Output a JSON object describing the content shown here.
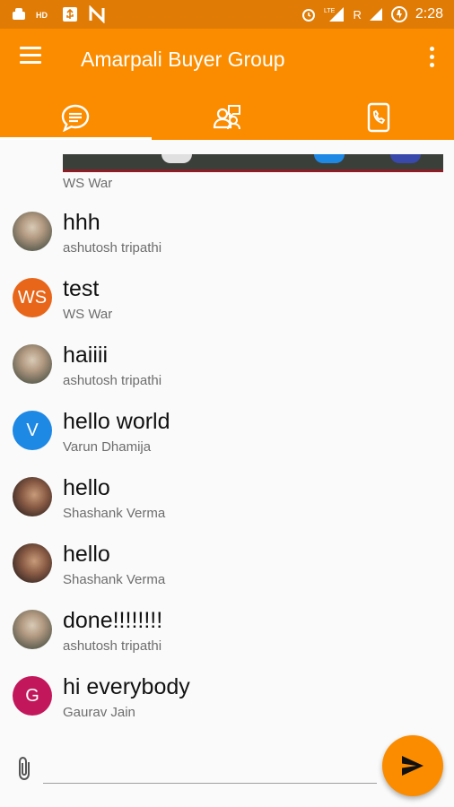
{
  "status_bar": {
    "time": "2:28",
    "network_label": "R"
  },
  "app": {
    "title": "Amarpali Buyer Group"
  },
  "tabs": [
    {
      "icon": "chat-bubble-icon",
      "active": true
    },
    {
      "icon": "group-icon",
      "active": false
    },
    {
      "icon": "contact-phone-icon",
      "active": false
    }
  ],
  "previous_message": {
    "sender": "WS War"
  },
  "messages": [
    {
      "text": " hhh",
      "sender": "ashutosh tripathi",
      "avatar": "photo"
    },
    {
      "text": "test",
      "sender": "WS War",
      "avatar": "WS",
      "avatar_color": "#e8661a"
    },
    {
      "text": "haiiii",
      "sender": "ashutosh tripathi",
      "avatar": "photo"
    },
    {
      "text": "hello world",
      "sender": "Varun Dhamija",
      "avatar": "V",
      "avatar_color": "#1e88e5"
    },
    {
      "text": "hello",
      "sender": "Shashank Verma",
      "avatar": "photo"
    },
    {
      "text": "hello",
      "sender": "Shashank Verma",
      "avatar": "photo"
    },
    {
      "text": "done!!!!!!!!",
      "sender": "ashutosh tripathi",
      "avatar": "photo"
    },
    {
      "text": "hi everybody",
      "sender": "Gaurav Jain",
      "avatar": "G",
      "avatar_color": "#c2185b"
    }
  ],
  "composer": {
    "value": "",
    "placeholder": ""
  },
  "colors": {
    "app_bar": "#fb8c00",
    "status_bar": "#e07b05",
    "send_button": "#fb8c00"
  }
}
